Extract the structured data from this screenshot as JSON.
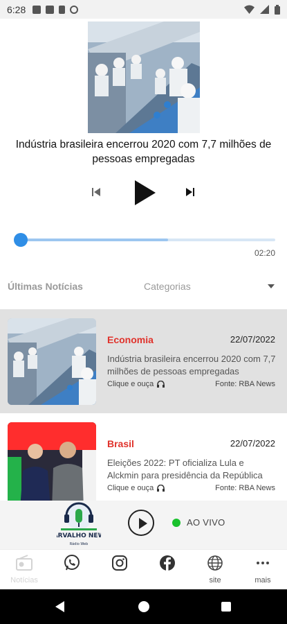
{
  "status_bar": {
    "time": "6:28",
    "icons": [
      "image-icon",
      "mail-icon",
      "clipboard-icon",
      "no-sync-icon",
      "wifi-icon",
      "signal-icon",
      "battery-icon"
    ]
  },
  "player": {
    "now_playing_title": "Indústria brasileira encerrou 2020 com 7,7 milhões de pessoas empregadas",
    "duration": "02:20",
    "progress_fraction": 0.58
  },
  "tabs": {
    "latest": "Últimas Notícias",
    "categories": "Categorias"
  },
  "news": [
    {
      "category": "Economia",
      "date": "22/07/2022",
      "title": "Indústria brasileira encerrou 2020 com 7,7 milhões de pessoas empregadas",
      "listen_label": "Clique e ouça",
      "source": "Fonte: RBA News",
      "active": true
    },
    {
      "category": "Brasil",
      "date": "22/07/2022",
      "title": "Eleições 2022: PT oficializa Lula e Alckmin para presidência da República",
      "listen_label": "Clique e ouça",
      "source": "Fonte: RBA News",
      "active": false
    }
  ],
  "live": {
    "label": "AO VIVO",
    "logo_text": "CARVALHO NEWS",
    "logo_subtext": "Rádio Web"
  },
  "bottom_nav": [
    {
      "icon": "radio-icon",
      "label": "Notícias"
    },
    {
      "icon": "whatsapp-icon",
      "label": ""
    },
    {
      "icon": "instagram-icon",
      "label": ""
    },
    {
      "icon": "facebook-icon",
      "label": ""
    },
    {
      "icon": "globe-icon",
      "label": "site"
    },
    {
      "icon": "more-icon",
      "label": "mais"
    }
  ],
  "colors": {
    "accent_blue": "#2f8ee6",
    "category_red": "#e0322b",
    "live_green": "#1ac12d"
  }
}
